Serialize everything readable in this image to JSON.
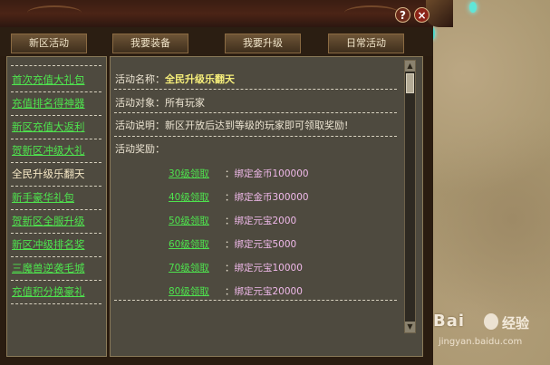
{
  "window": {
    "help_icon": "?",
    "close_icon": "×"
  },
  "tabs": [
    {
      "label": "新区活动"
    },
    {
      "label": "我要装备"
    },
    {
      "label": "我要升级"
    },
    {
      "label": "日常活动"
    }
  ],
  "sidebar": {
    "items": [
      {
        "label": "首次充值大礼包",
        "active": false
      },
      {
        "label": "充值排名得神器",
        "active": false
      },
      {
        "label": "新区充值大返利",
        "active": false
      },
      {
        "label": "贺新区冲级大礼",
        "active": false
      },
      {
        "label": "全民升级乐翻天",
        "active": true
      },
      {
        "label": "新手豪华礼包",
        "active": false
      },
      {
        "label": "贺新区全服升级",
        "active": false
      },
      {
        "label": "新区冲级排名奖",
        "active": false
      },
      {
        "label": "三魔兽逆袭毛城",
        "active": false
      },
      {
        "label": "充值积分换豪礼",
        "active": false
      }
    ]
  },
  "detail": {
    "name_label": "活动名称：",
    "name_value": "全民升级乐翻天",
    "target_label": "活动对象：",
    "target_value": "所有玩家",
    "desc_label": "活动说明：",
    "desc_value": "新区开放后达到等级的玩家即可领取奖励!",
    "reward_label": "活动奖励："
  },
  "rewards": [
    {
      "link": "30级领取",
      "sep": "：",
      "desc": "绑定金币100000"
    },
    {
      "link": "40级领取",
      "sep": "：",
      "desc": "绑定金币300000"
    },
    {
      "link": "50级领取",
      "sep": "：",
      "desc": "绑定元宝2000"
    },
    {
      "link": "60级领取",
      "sep": "：",
      "desc": "绑定元宝5000"
    },
    {
      "link": "70级领取",
      "sep": "：",
      "desc": "绑定元宝10000"
    },
    {
      "link": "80级领取",
      "sep": "：",
      "desc": "绑定元宝20000"
    }
  ],
  "watermark": {
    "brand": "Bai",
    "brand2": "经验",
    "url": "jingyan.baidu.com"
  },
  "colors": {
    "link_green": "#4ee34e",
    "title_yellow": "#f6ee7a",
    "reward_pink": "#f0b9ea"
  }
}
